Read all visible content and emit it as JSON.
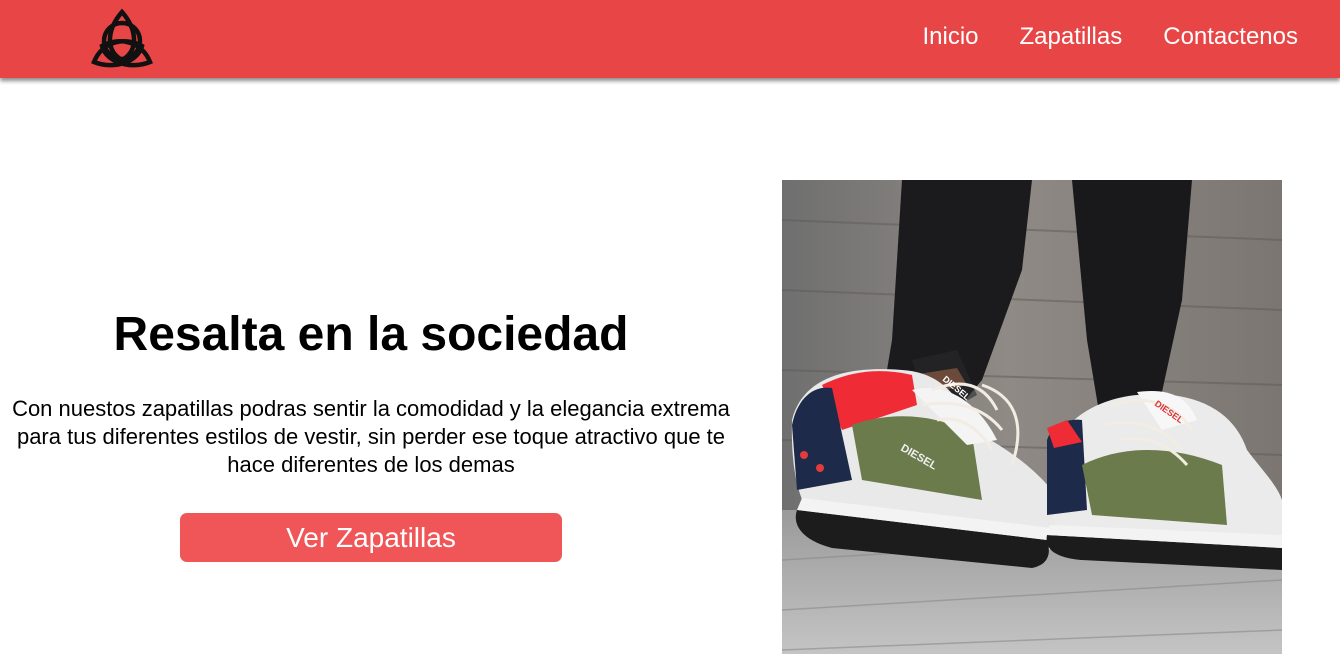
{
  "nav": {
    "logo_icon": "triquetra-logo-icon",
    "links": [
      {
        "label": "Inicio"
      },
      {
        "label": "Zapatillas"
      },
      {
        "label": "Contactenos"
      }
    ]
  },
  "hero": {
    "title": "Resalta en la sociedad",
    "description": "Con nuestos zapatillas podras sentir la comodidad y la elegancia extrema para tus diferentes estilos de vestir, sin perder ese toque atractivo que te hace diferentes de los demas",
    "cta_label": "Ver Zapatillas",
    "image_icon": "sneakers-photo",
    "shoe_brand": "DIESEL"
  },
  "colors": {
    "brand": "#e84646",
    "button": "#f05558",
    "text": "#000000"
  }
}
